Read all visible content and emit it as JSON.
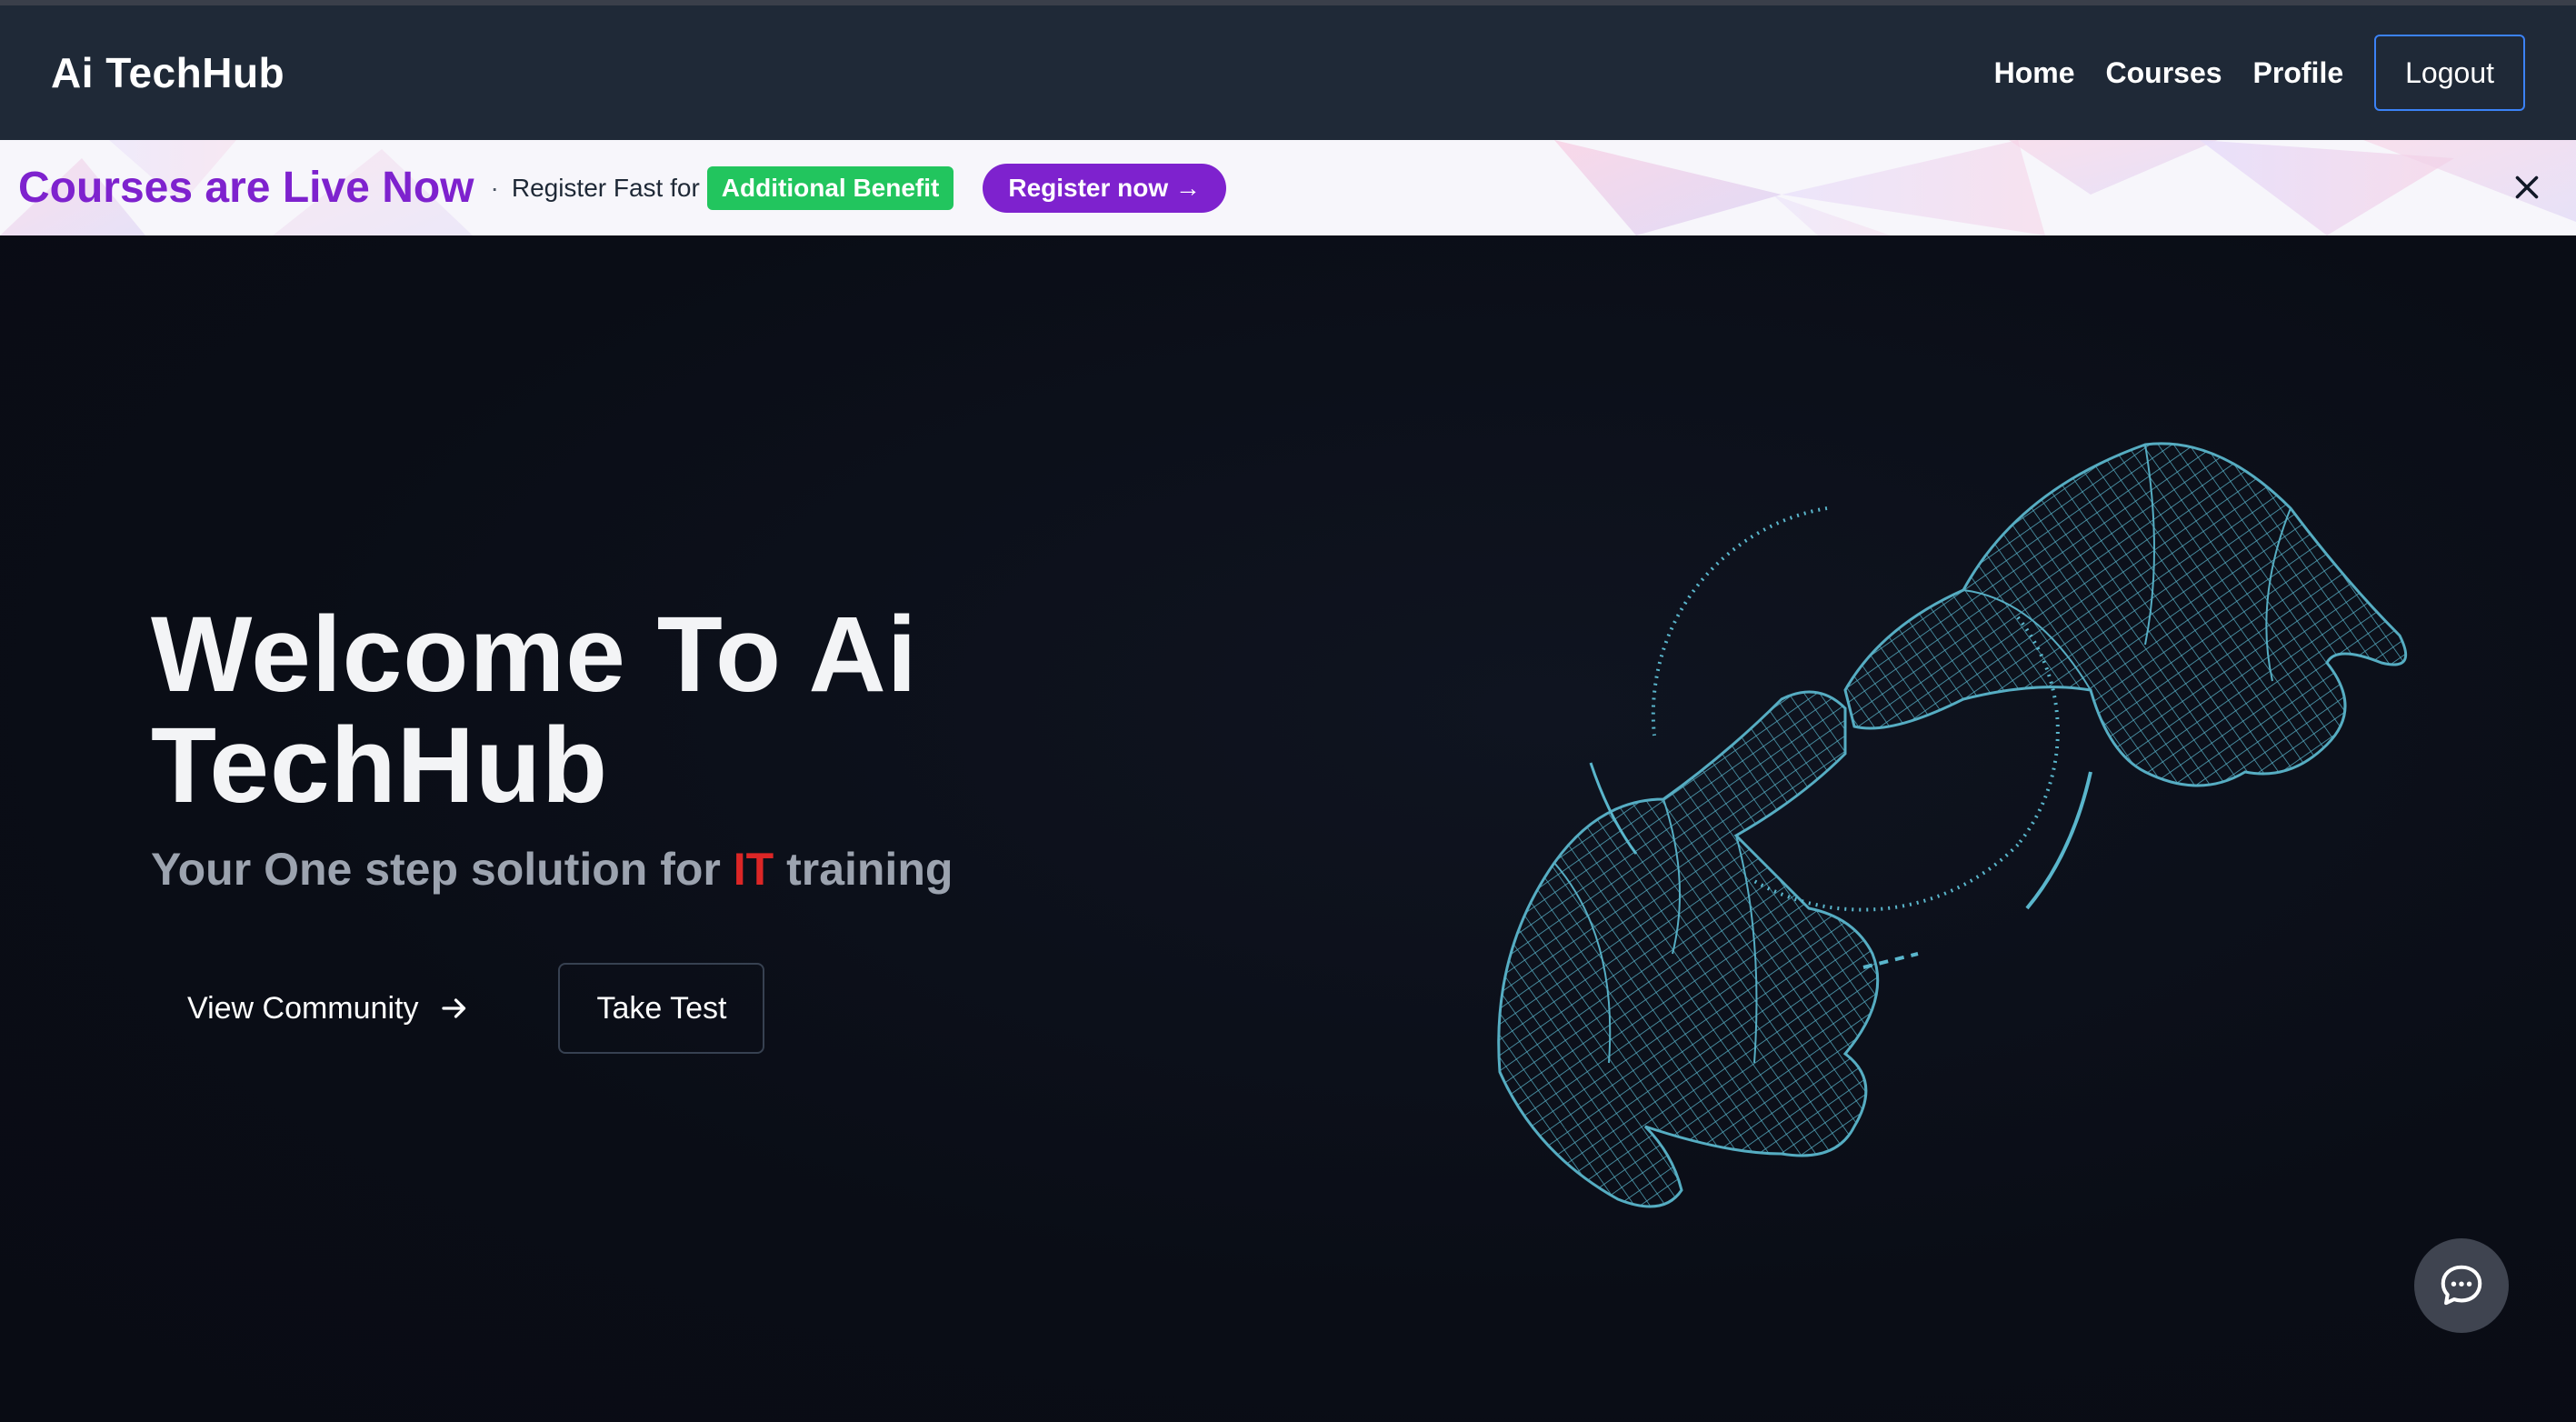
{
  "navbar": {
    "brand": "Ai TechHub",
    "links": [
      "Home",
      "Courses",
      "Profile"
    ],
    "logout_label": "Logout"
  },
  "banner": {
    "headline": "Courses are Live Now",
    "separator": "·",
    "text": "Register Fast for",
    "badge": "Additional Benefit",
    "register_label": "Register now →"
  },
  "hero": {
    "title": "Welcome To Ai TechHub",
    "subtitle_before": "Your One step solution for ",
    "subtitle_accent": "IT",
    "subtitle_after": " training",
    "community_label": "View Community",
    "test_label": "Take Test"
  },
  "icons": {
    "close": "close-icon",
    "arrow": "arrow-right-icon",
    "chat": "chat-bubble-icon"
  },
  "colors": {
    "navbar_bg": "#1f2937",
    "accent_purple": "#7e22ce",
    "badge_green": "#22c55e",
    "accent_red": "#dc2626",
    "logout_border": "#3b82f6",
    "wireframe": "#5ab6cc"
  }
}
